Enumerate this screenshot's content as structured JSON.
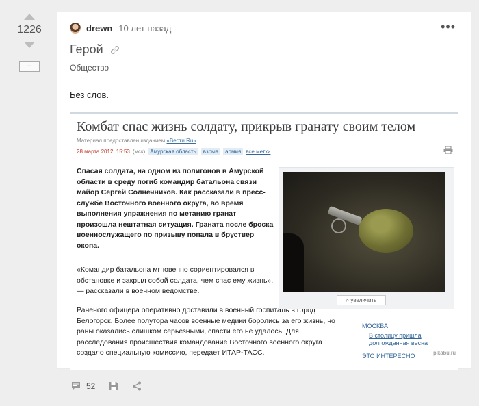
{
  "votes": {
    "rating": "1226",
    "minus_label": "–"
  },
  "post": {
    "author": "drewn",
    "time": "10 лет назад",
    "title": "Герой",
    "tag": "Общество",
    "text": "Без слов."
  },
  "article": {
    "title": "Комбат спас жизнь солдату, прикрыв гранату своим телом",
    "source_prefix": "Материал предоставлен изданием",
    "source_name": "«Вести.Ru»",
    "date": "28 марта 2012, 15:53",
    "zone": "(мск)",
    "tags": [
      "Амурская область",
      "взрыв",
      "армия"
    ],
    "all_tags": "все метки",
    "lead": "Спасая солдата, на одном из полигонов в Амурской области в среду погиб командир батальона связи майор Сергей Солнечников. Как рассказали в пресс-службе Восточного военного округа, во время выполнения упражнения по метанию гранат произошла нештатная ситуация. Граната после броска военнослужащего по призыву попала в бруствер окопа.",
    "quote": "«Командир батальона мгновенно сориентировался в обстановке и закрыл собой солдата, чем спас ему жизнь», — рассказали в военном ведомстве.",
    "rest": "Раненого офицера оперативно доставили в военный госпиталь в город Белогорск. Более полутора часов военные медики боролись за его жизнь, но раны оказались слишком серьезными, спасти его не удалось. Для расследования происшествия командование Восточного военного округа создало специальную комиссию, передает ИТАР-ТАСС.",
    "zoom_label": "увеличить",
    "side_city": "МОСКВА",
    "side_link": "В столицу пришла долгожданная весна",
    "interesting": "ЭТО ИНТЕРЕСНО",
    "watermark": "pikabu.ru"
  },
  "actions": {
    "comments_count": "52"
  }
}
